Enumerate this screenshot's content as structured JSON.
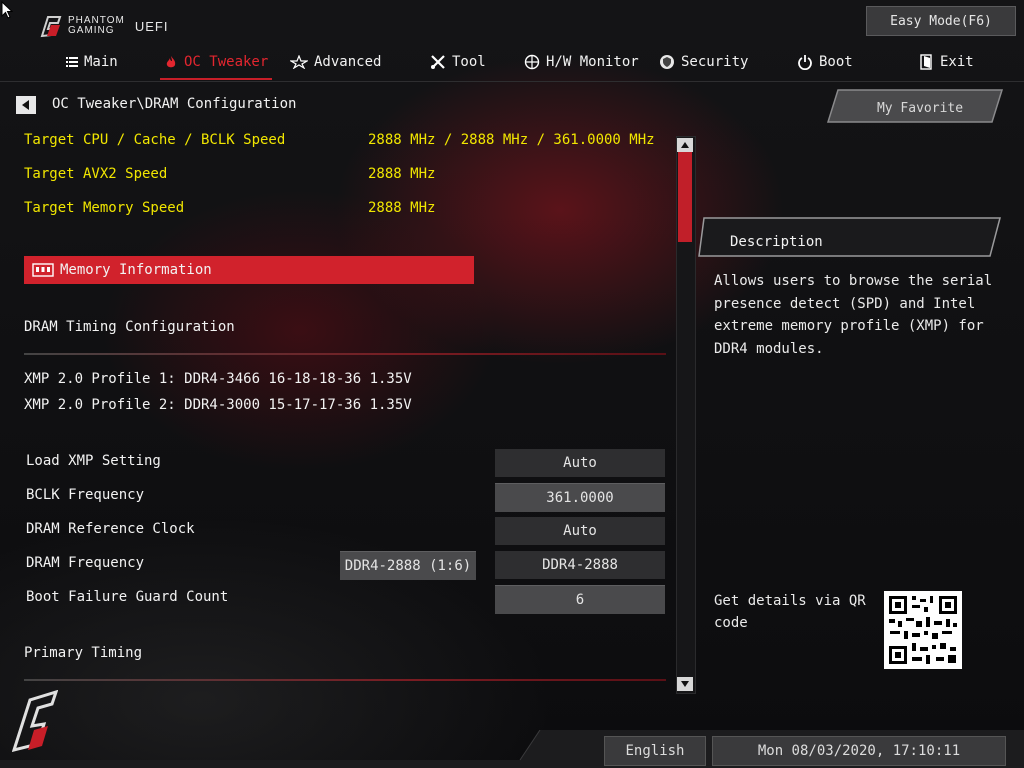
{
  "brand": {
    "line1": "PHANTOM",
    "line2": "GAMING",
    "product": "UEFI"
  },
  "header": {
    "easy_mode": "Easy Mode(F6)"
  },
  "nav": {
    "items": [
      {
        "label": "Main",
        "icon": "list-icon"
      },
      {
        "label": "OC Tweaker",
        "icon": "flame-icon",
        "active": true
      },
      {
        "label": "Advanced",
        "icon": "star-icon"
      },
      {
        "label": "Tool",
        "icon": "tools-icon"
      },
      {
        "label": "H/W Monitor",
        "icon": "crosshair-icon"
      },
      {
        "label": "Security",
        "icon": "shield-icon"
      },
      {
        "label": "Boot",
        "icon": "power-icon"
      },
      {
        "label": "Exit",
        "icon": "exit-icon"
      }
    ]
  },
  "breadcrumb": "OC Tweaker\\DRAM Configuration",
  "favorite": "My Favorite",
  "targets": [
    {
      "label": "Target CPU / Cache / BCLK Speed",
      "value": "2888 MHz / 2888 MHz / 361.0000 MHz"
    },
    {
      "label": "Target AVX2 Speed",
      "value": "2888 MHz"
    },
    {
      "label": "Target Memory Speed",
      "value": "2888 MHz"
    }
  ],
  "memory_info": "Memory Information",
  "dram_timing_section": "DRAM Timing Configuration",
  "xmp_profiles": [
    "XMP 2.0 Profile 1: DDR4-3466 16-18-18-36 1.35V",
    "XMP 2.0 Profile 2: DDR4-3000 15-17-17-36 1.35V"
  ],
  "settings": [
    {
      "label": "Load XMP Setting",
      "value": "Auto"
    },
    {
      "label": "BCLK Frequency",
      "value": "361.0000"
    },
    {
      "label": "DRAM Reference Clock",
      "value": "Auto"
    },
    {
      "label": "DRAM Frequency",
      "current": "DDR4-2888 (1:6)",
      "value": "DDR4-2888"
    },
    {
      "label": "Boot Failure Guard Count",
      "value": "6"
    }
  ],
  "primary_timing": "Primary Timing",
  "description": {
    "title": "Description",
    "text": "Allows users to browse the serial presence detect (SPD) and Intel extreme memory profile (XMP) for DDR4 modules."
  },
  "qr_text": "Get details via QR code",
  "footer": {
    "language": "English",
    "datetime": "Mon 08/03/2020, 17:10:11"
  },
  "colors": {
    "accent": "#d1222c",
    "highlight_text": "#f1e600",
    "active_tab": "#e3262f"
  }
}
